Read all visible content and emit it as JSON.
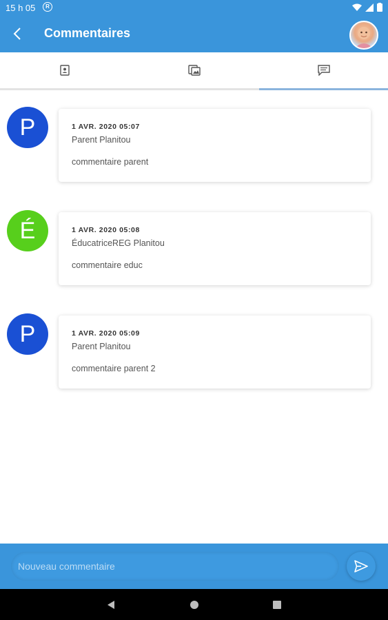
{
  "status_bar": {
    "time": "15 h 05",
    "notification_icon": "r-circle-icon"
  },
  "app_bar": {
    "title": "Commentaires",
    "back_icon": "back-arrow-icon",
    "avatar": "child-avatar"
  },
  "tabs": [
    {
      "icon": "contact-card-icon",
      "selected": false
    },
    {
      "icon": "image-card-icon",
      "selected": false
    },
    {
      "icon": "comments-icon",
      "selected": true
    }
  ],
  "comments": [
    {
      "initial": "P",
      "color": "#1a50d4",
      "date": "1 AVR. 2020 05:07",
      "author": "Parent Planitou",
      "text": "commentaire parent"
    },
    {
      "initial": "É",
      "color": "#57cf1c",
      "date": "1 AVR. 2020 05:08",
      "author": "ÉducatriceREG Planitou",
      "text": "commentaire educ"
    },
    {
      "initial": "P",
      "color": "#1a50d4",
      "date": "1 AVR. 2020 05:09",
      "author": "Parent Planitou",
      "text": "commentaire parent 2"
    }
  ],
  "composer": {
    "placeholder": "Nouveau commentaire",
    "send_icon": "send-icon"
  },
  "colors": {
    "primary": "#3a95db",
    "parent_avatar": "#1a50d4",
    "educ_avatar": "#57cf1c"
  }
}
